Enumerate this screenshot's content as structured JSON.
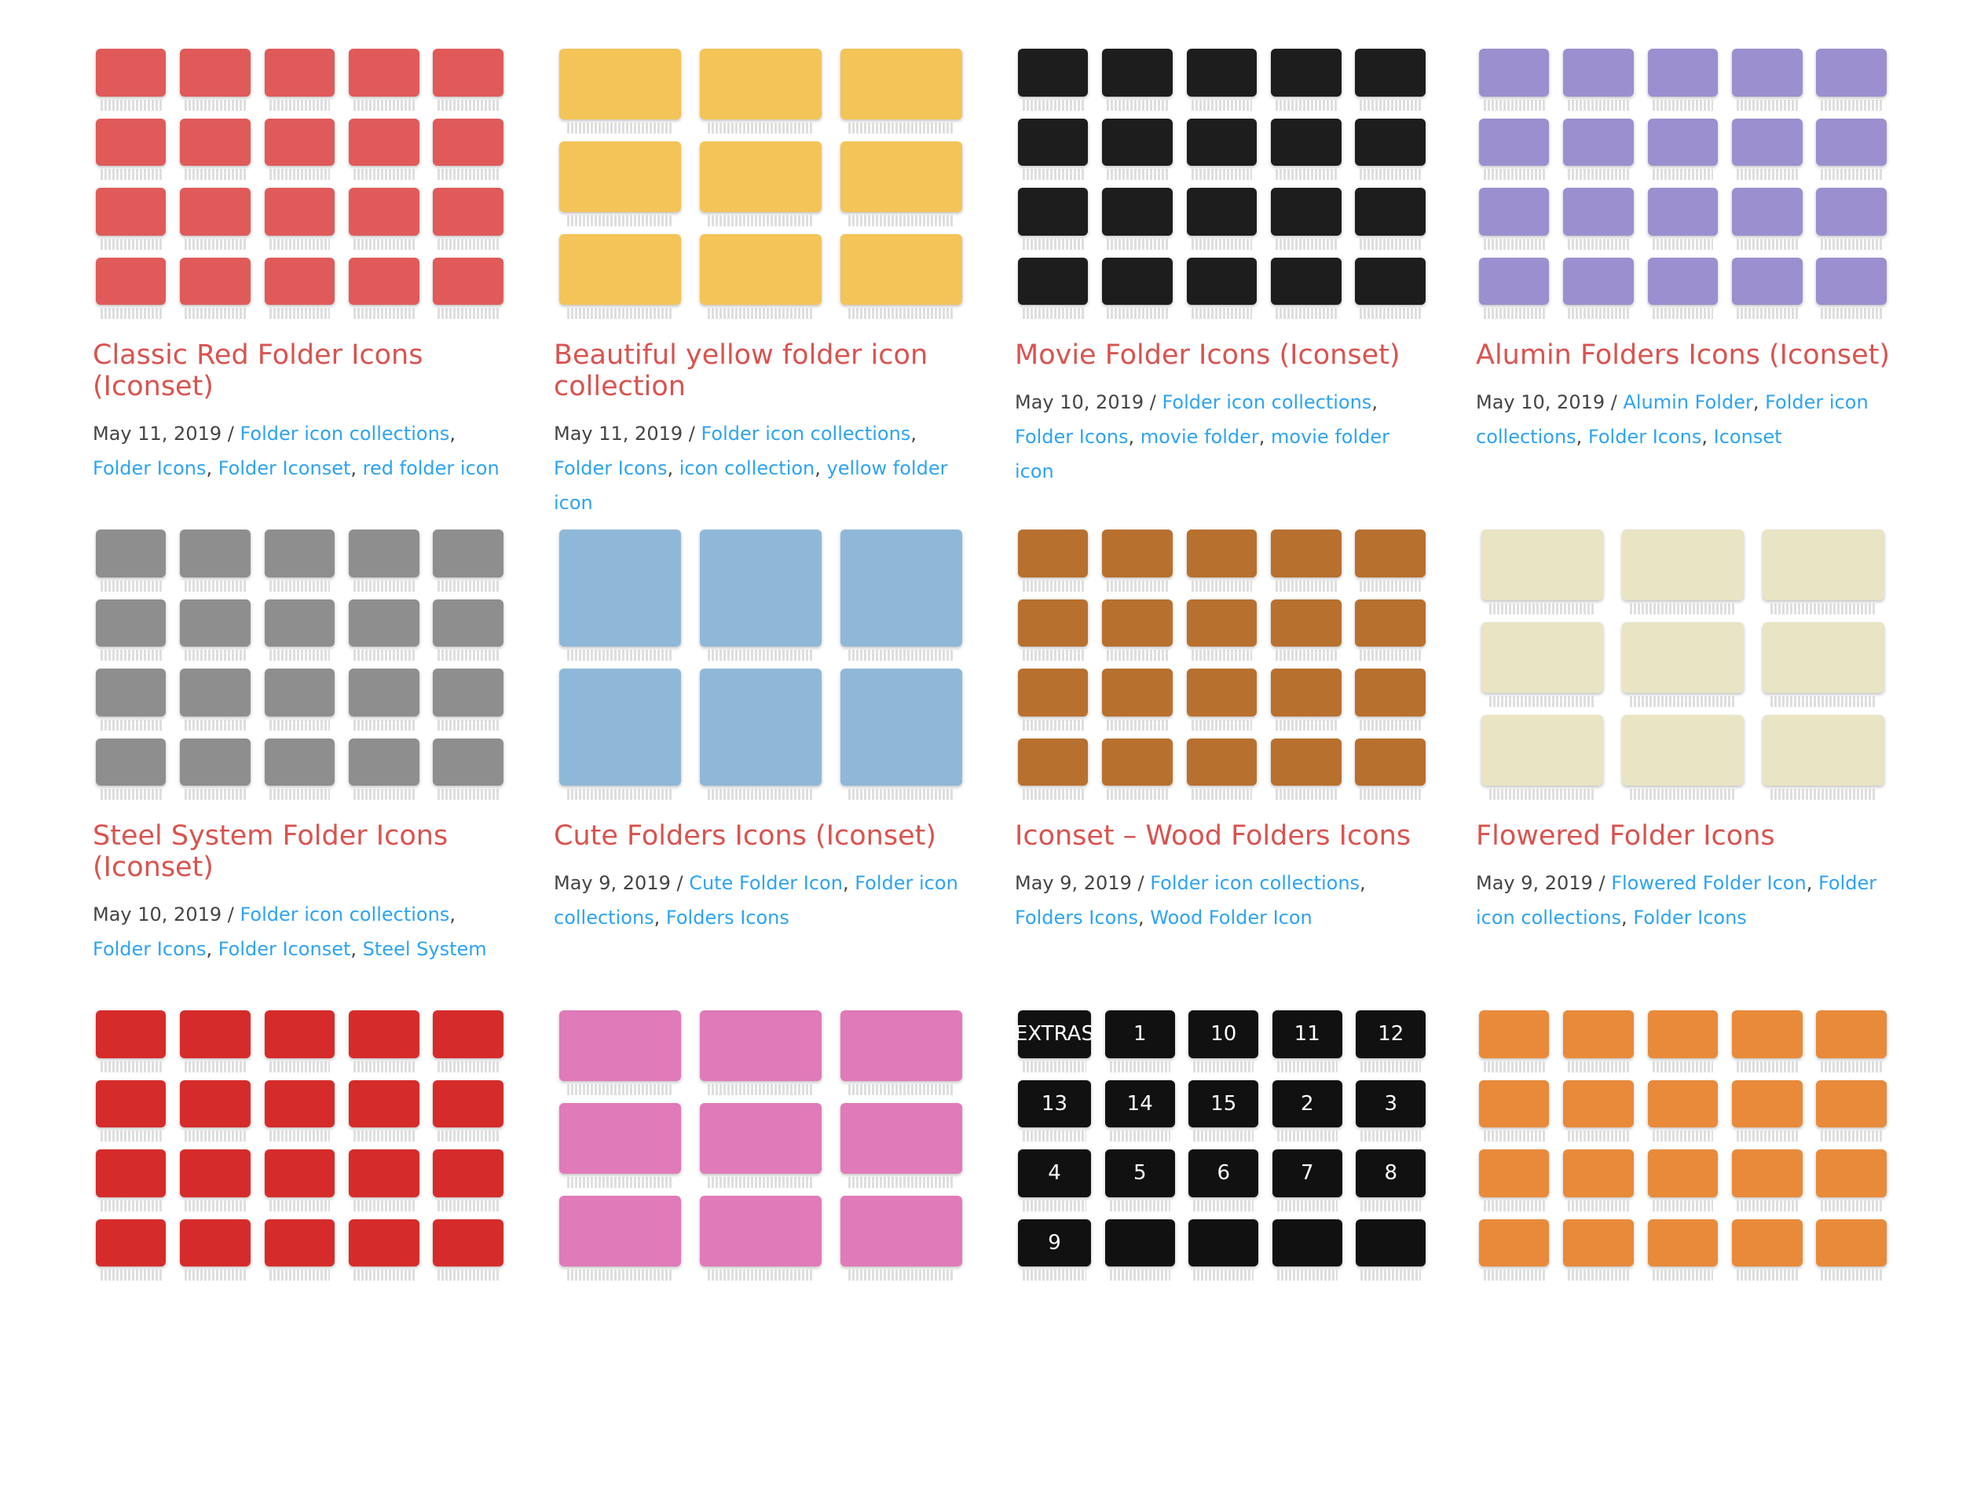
{
  "posts": [
    {
      "title": "Classic Red Folder Icons (Iconset)",
      "date": "May 11, 2019",
      "tags": [
        "Folder icon collections",
        "Folder Icons",
        "Folder Iconset",
        "red folder icon"
      ],
      "thumb_color": "#e05a5a",
      "cols": 5,
      "rows": 4
    },
    {
      "title": "Beautiful yellow folder icon collection",
      "date": "May 11, 2019",
      "tags": [
        "Folder icon collections",
        "Folder Icons",
        "icon collection",
        "yellow folder icon"
      ],
      "thumb_color": "#f3c457",
      "cols": 3,
      "rows": 3
    },
    {
      "title": "Movie Folder Icons (Iconset)",
      "date": "May 10, 2019",
      "tags": [
        "Folder icon collections",
        "Folder Icons",
        "movie folder",
        "movie folder icon"
      ],
      "thumb_color": "#1d1d1d",
      "cols": 5,
      "rows": 4
    },
    {
      "title": "Alumin Folders Icons (Iconset)",
      "date": "May 10, 2019",
      "tags": [
        "Alumin Folder",
        "Folder icon collections",
        "Folder Icons",
        "Iconset"
      ],
      "thumb_color": "#9b8fd0",
      "cols": 5,
      "rows": 4
    },
    {
      "title": "Steel System Folder Icons (Iconset)",
      "date": "May 10, 2019",
      "tags": [
        "Folder icon collections",
        "Folder Icons",
        "Folder Iconset",
        "Steel System"
      ],
      "thumb_color": "#8e8e8e",
      "cols": 5,
      "rows": 4
    },
    {
      "title": "Cute Folders Icons (Iconset)",
      "date": "May 9, 2019",
      "tags": [
        "Cute Folder Icon",
        "Folder icon collections",
        "Folders Icons"
      ],
      "thumb_color": "#8fb8d8",
      "cols": 3,
      "rows": 2
    },
    {
      "title": "Iconset – Wood Folders Icons",
      "date": "May 9, 2019",
      "tags": [
        "Folder icon collections",
        "Folders Icons",
        "Wood Folder Icon"
      ],
      "thumb_color": "#b8702f",
      "cols": 5,
      "rows": 4
    },
    {
      "title": "Flowered Folder Icons",
      "date": "May 9, 2019",
      "tags": [
        "Flowered Folder Icon",
        "Folder icon collections",
        "Folder Icons"
      ],
      "thumb_color": "#e8e4c4",
      "cols": 3,
      "rows": 3
    },
    {
      "title": "",
      "date": "",
      "tags": [],
      "thumb_color": "#d62b2b",
      "cols": 5,
      "rows": 4
    },
    {
      "title": "",
      "date": "",
      "tags": [],
      "thumb_color": "#e07ab8",
      "cols": 3,
      "rows": 3
    },
    {
      "title": "",
      "date": "",
      "tags": [],
      "thumb_color": "#111111",
      "cols": 5,
      "rows": 4,
      "tile_labels": [
        "EXTRAS",
        "1",
        "10",
        "11",
        "12",
        "13",
        "14",
        "15",
        "2",
        "3",
        "4",
        "5",
        "6",
        "7",
        "8",
        "9"
      ]
    },
    {
      "title": "",
      "date": "",
      "tags": [],
      "thumb_color": "#e88a3a",
      "cols": 5,
      "rows": 4
    }
  ]
}
